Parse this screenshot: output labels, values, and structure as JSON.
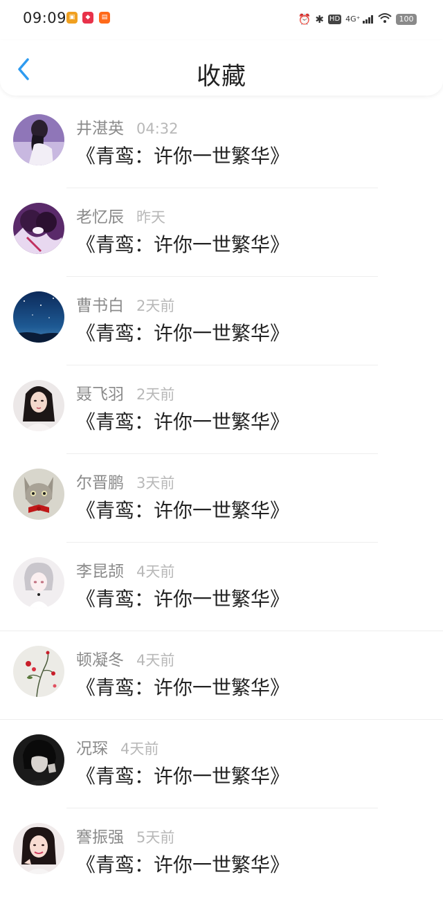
{
  "status_bar": {
    "time": "09:09",
    "network": "4G⁺",
    "hd": "HD",
    "battery": "100"
  },
  "header": {
    "title": "收藏"
  },
  "colors": {
    "accent": "#2e9bf0",
    "name_text": "#8a8a8a",
    "time_text": "#b8b8b8",
    "title_text": "#222222"
  },
  "favorites": [
    {
      "name": "井湛英",
      "time": "04:32",
      "title": "《青鸾：许你一世繁华》",
      "avatar": "girl-sitting-purple"
    },
    {
      "name": "老忆辰",
      "time": "昨天",
      "title": "《青鸾：许你一世繁华》",
      "avatar": "anime-couple"
    },
    {
      "name": "曹书白",
      "time": "2天前",
      "title": "《青鸾：许你一世繁华》",
      "avatar": "night-sky"
    },
    {
      "name": "聂飞羽",
      "time": "2天前",
      "title": "《青鸾：许你一世繁华》",
      "avatar": "woman-portrait"
    },
    {
      "name": "尔晋鹏",
      "time": "3天前",
      "title": "《青鸾：许你一世繁华》",
      "avatar": "kitten-bowtie"
    },
    {
      "name": "李昆颉",
      "time": "4天前",
      "title": "《青鸾：许你一世繁华》",
      "avatar": "anime-boy"
    },
    {
      "name": "顿凝冬",
      "time": "4天前",
      "title": "《青鸾：许你一世繁华》",
      "avatar": "red-flowers"
    },
    {
      "name": "况琛",
      "time": "4天前",
      "title": "《青鸾：许你一世繁华》",
      "avatar": "man-dark"
    },
    {
      "name": "謇振强",
      "time": "5天前",
      "title": "《青鸾：许你一世繁华》",
      "avatar": "woman-smile"
    }
  ]
}
